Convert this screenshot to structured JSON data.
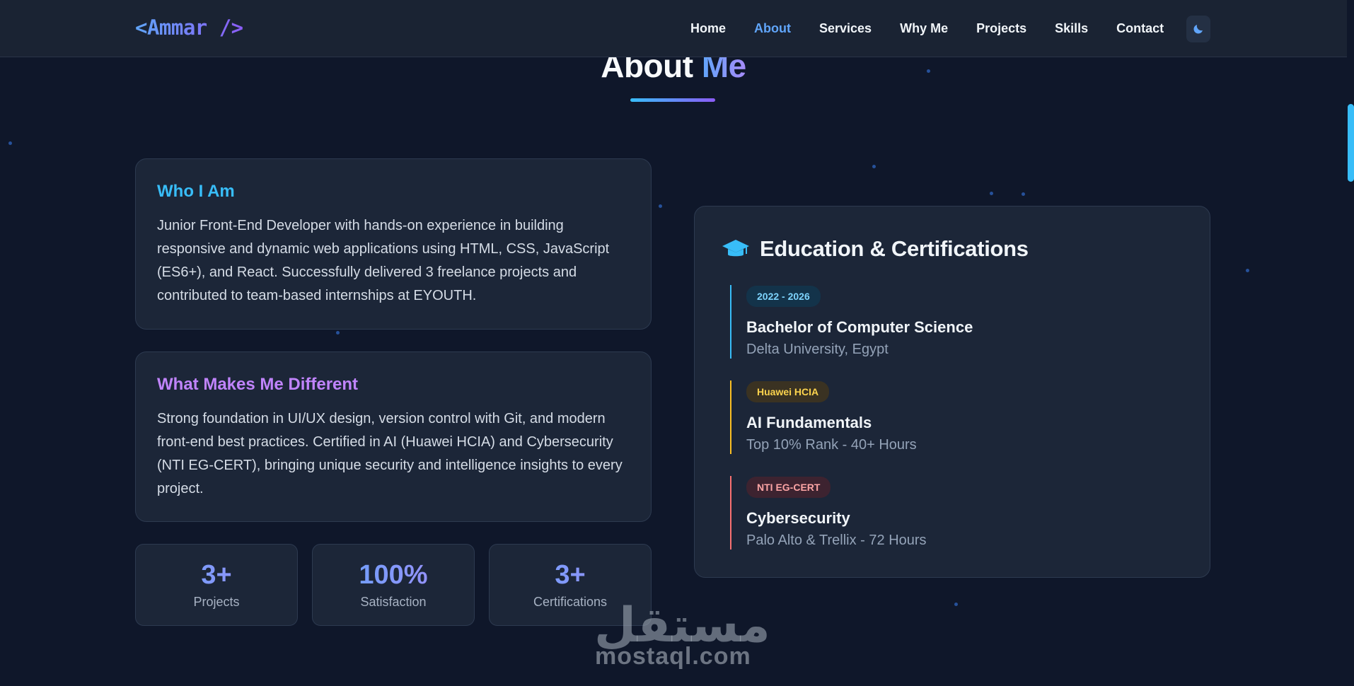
{
  "nav": {
    "logo": "<Ammar />",
    "links": [
      "Home",
      "About",
      "Services",
      "Why Me",
      "Projects",
      "Skills",
      "Contact"
    ],
    "active": "About",
    "theme_icon": "moon-icon"
  },
  "section": {
    "title_main": "About",
    "title_accent": "Me"
  },
  "who": {
    "heading": "Who I Am",
    "text": "Junior Front-End Developer with hands-on experience in building responsive and dynamic web applications using HTML, CSS, JavaScript (ES6+), and React. Successfully delivered 3 freelance projects and contributed to team-based internships at EYOUTH."
  },
  "different": {
    "heading": "What Makes Me Different",
    "text": "Strong foundation in UI/UX design, version control with Git, and modern front-end best practices. Certified in AI (Huawei HCIA) and Cybersecurity (NTI EG-CERT), bringing unique security and intelligence insights to every project."
  },
  "stats": [
    {
      "value": "3+",
      "label": "Projects"
    },
    {
      "value": "100%",
      "label": "Satisfaction"
    },
    {
      "value": "3+",
      "label": "Certifications"
    }
  ],
  "education": {
    "icon": "graduation-cap-icon",
    "heading": "Education & Certifications",
    "items": [
      {
        "badge": "2022 - 2026",
        "title": "Bachelor of Computer Science",
        "sub": "Delta University, Egypt",
        "color": "#38bdf8"
      },
      {
        "badge": "Huawei HCIA",
        "title": "AI Fundamentals",
        "sub": "Top 10% Rank - 40+ Hours",
        "color": "#fbbf24"
      },
      {
        "badge": "NTI EG-CERT",
        "title": "Cybersecurity",
        "sub": "Palo Alto & Trellix - 72 Hours",
        "color": "#f87171"
      }
    ]
  },
  "watermark": {
    "arabic": "مستقل",
    "latin": "mostaql.com"
  }
}
